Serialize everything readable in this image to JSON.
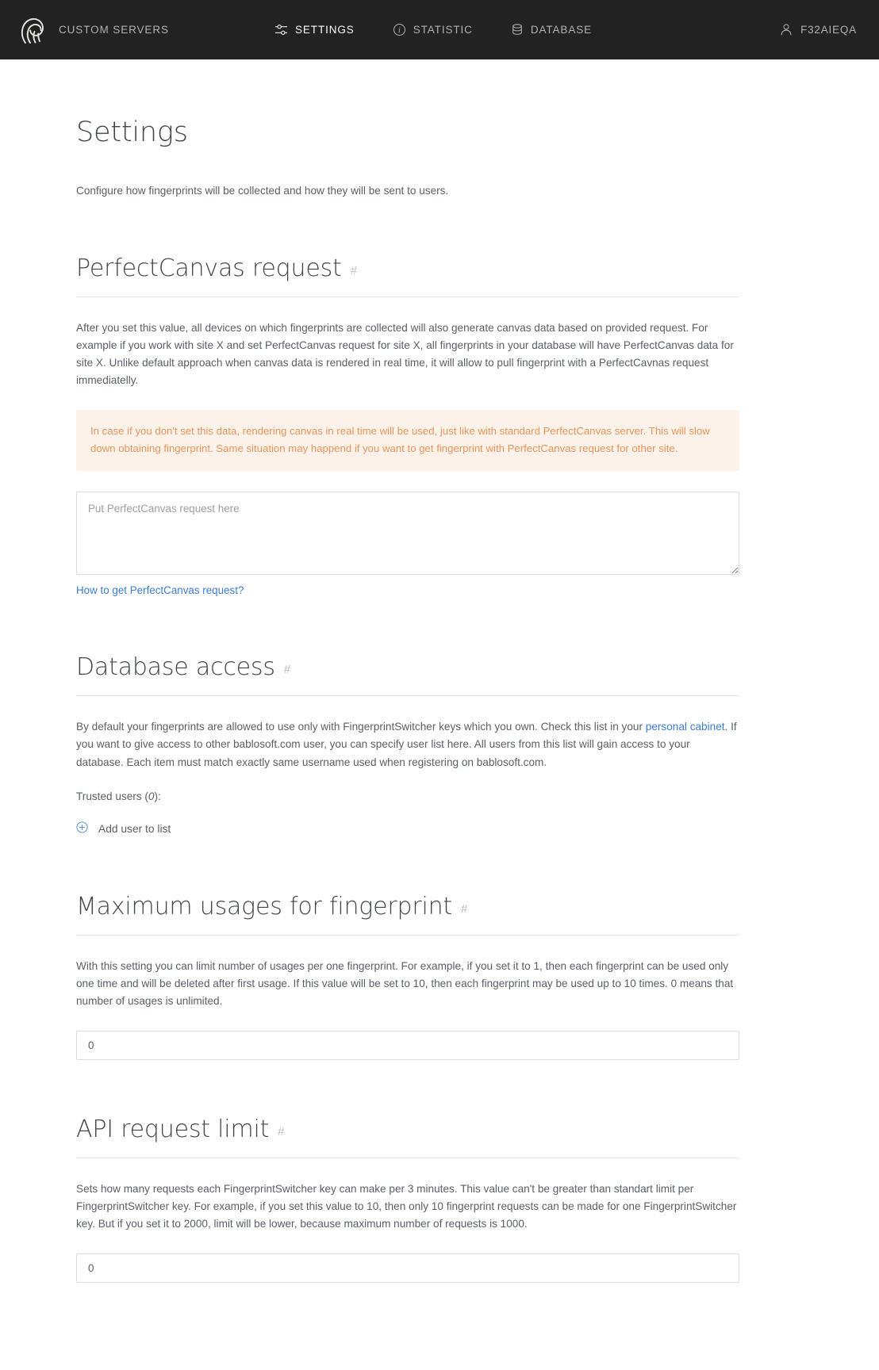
{
  "colors": {
    "navbar_bg": "#222222",
    "nav_text": "#b4b0ad",
    "nav_active": "#ffffff",
    "accent_link": "#3b7dd8",
    "warning_bg": "#fdf2e9",
    "warning_text": "#e8945a",
    "heading": "#42464b",
    "body_text": "#5a6066"
  },
  "navbar": {
    "brand": {
      "icon": "fingerprint-icon",
      "label": "CUSTOM SERVERS"
    },
    "items": [
      {
        "label": "SETTINGS",
        "icon": "sliders-icon",
        "active": true
      },
      {
        "label": "STATISTIC",
        "icon": "info-circle-icon",
        "active": false
      },
      {
        "label": "DATABASE",
        "icon": "database-icon",
        "active": false
      }
    ],
    "user": {
      "icon": "user-icon",
      "label": "F32AIEQA"
    }
  },
  "page": {
    "title": "Settings",
    "subtitle": "Configure how fingerprints will be collected and how they will be sent to users."
  },
  "sections": {
    "perfectcanvas": {
      "title": "PerfectCanvas request",
      "anchor": "#",
      "description": "After you set this value, all devices on which fingerprints are collected will also generate canvas data based on provided request. For example if you work with site X and set PerfectCanvas request for site X, all fingerprints in your database will have PerfectCanvas data for site X. Unlike default approach when canvas data is rendered in real time, it will allow to pull fingerprint with a PerfectCavnas request immediatelly.",
      "warning": "In case if you don't set this data, rendering canvas in real time will be used, just like with standard PerfectCanvas server. This will slow down obtaining fingerprint. Same situation may happend if you want to get fingerprint with PerfectCanvas request for other site.",
      "textarea_placeholder": "Put PerfectCanvas request here",
      "textarea_value": "",
      "help_link": "How to get PerfectCanvas request?"
    },
    "database_access": {
      "title": "Database access",
      "anchor": "#",
      "desc_part1": "By default your fingerprints are allowed to use only with FingerprintSwitcher keys which you own. Check this list in your ",
      "desc_link": "personal cabinet",
      "desc_part2": ". If you want to give access to other bablosoft.com user, you can specify user list here. All users from this list will gain access to your database. Each item must match exactly same username used when registering on bablosoft.com.",
      "trusted_users_label_prefix": "Trusted users (",
      "trusted_users_count": "0",
      "trusted_users_label_suffix": "):",
      "add_user_label": "Add user to list",
      "add_user_icon": "plus-circle-icon"
    },
    "max_usages": {
      "title": "Maximum usages for fingerprint",
      "anchor": "#",
      "description": "With this setting you can limit number of usages per one fingerprint. For example, if you set it to 1, then each fingerprint can be used only one time and will be deleted after first usage. If this value will be set to 10, then each fingerprint may be used up to 10 times. 0 means that number of usages is unlimited.",
      "input_value": "0"
    },
    "api_limit": {
      "title": "API request limit",
      "anchor": "#",
      "description": "Sets how many requests each FingerprintSwitcher key can make per 3 minutes. This value can't be greater than standart limit per FingerprintSwitcher key. For example, if you set this value to 10, then only 10 fingerprint requests can be made for one FingerprintSwitcher key. But if you set it to 2000, limit will be lower, because maximum number of requests is 1000.",
      "input_value": "0"
    }
  }
}
